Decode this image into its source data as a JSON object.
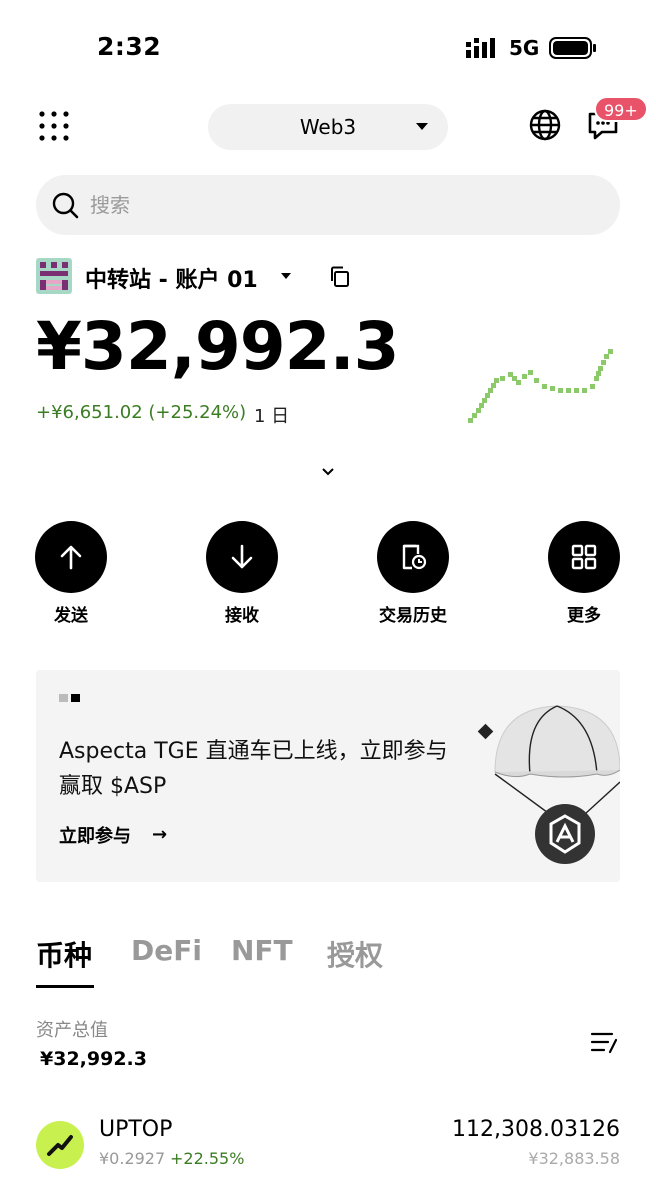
{
  "status_bar": {
    "time": "2:32",
    "network": "5G"
  },
  "header": {
    "network_selector": "Web3",
    "notification_badge": "99+"
  },
  "search": {
    "placeholder": "搜索"
  },
  "account": {
    "name": "中转站 - 账户 01",
    "balance": "¥32,992.3",
    "change": "+¥6,651.02 (+25.24%)",
    "period": "1 日"
  },
  "actions": [
    {
      "label": "发送",
      "icon": "arrow-up-icon"
    },
    {
      "label": "接收",
      "icon": "arrow-down-icon"
    },
    {
      "label": "交易历史",
      "icon": "history-icon"
    },
    {
      "label": "更多",
      "icon": "grid-icon"
    }
  ],
  "banner": {
    "title": "Aspecta TGE 直通车已上线，立即参与赢取 $ASP",
    "cta": "立即参与",
    "arrow": "→"
  },
  "tabs": [
    {
      "label": "币种",
      "active": true
    },
    {
      "label": "DeFi",
      "active": false
    },
    {
      "label": "NFT",
      "active": false
    },
    {
      "label": "授权",
      "active": false
    }
  ],
  "assets": {
    "label": "资产总值",
    "value": "¥32,992.3"
  },
  "tokens": [
    {
      "symbol": "UPTOP",
      "price": "¥0.2927",
      "change": "+22.55%",
      "amount": "112,308.03126",
      "fiat": "¥32,883.58"
    }
  ],
  "colors": {
    "positive": "#3b7d23",
    "badge": "#e8536a",
    "sparkline": "#8cc96a",
    "token_icon": "#c8f04e"
  }
}
